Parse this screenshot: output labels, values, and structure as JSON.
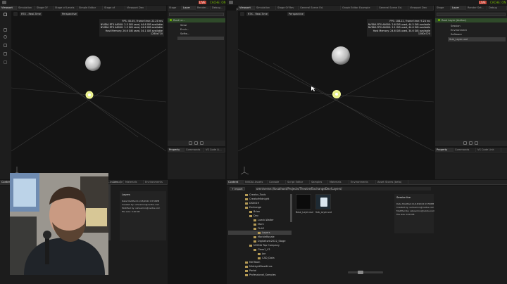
{
  "left_window": {
    "menu": [
      "File",
      "Edit",
      "Create",
      "Window",
      "Replicator",
      "Omniverse",
      "Layout",
      "Help"
    ],
    "live_badge": "LIVE",
    "cache_label": "CACHE: ON",
    "tabs": [
      "Viewport",
      "Simulation",
      "Stage Of Rev",
      "Stage of Levels",
      "Simple Editor Stage",
      "Stage of Levels",
      "Viewport Dev"
    ],
    "right_tabs": [
      "Stage",
      "Layer",
      "Render...",
      "Debug..."
    ],
    "viewport_toolbar": [
      "RTX - Real-Time",
      "Perspective"
    ],
    "stats": [
      "FPS: 45.05, Frame time: 22.20 ms",
      "NVIDIA RTX A6000: 2.5 GiB used, 44.6 GiB available",
      "NVIDIA RTX A6000: 1.5 GiB used, 44.6 GiB available",
      "Host Memory: 26.6 GiB used, 34.1 GiB available",
      "1280x720"
    ],
    "layer_rows": [
      "Root La...",
      "Sessi",
      "Envir...",
      "Softw..."
    ],
    "bottom_tabs": [
      "Property",
      "Commands",
      "VS Code Li..."
    ],
    "content_tabs": [
      "Content",
      "NVIDIA Assets",
      "Console",
      "Materials",
      "Environments"
    ],
    "file_panel": {
      "name": "Layers",
      "info": [
        "Date Modified:11/18/2022 03:58PM",
        "Created by: vshoemnn@nvidia.com",
        "Modified by: vshoemnn@nvidia.com",
        "File size: 0.00 KB"
      ]
    }
  },
  "right_window": {
    "menu": [
      "File",
      "Edit",
      "Create",
      "Window",
      "Replicator",
      "Omniverse",
      "Layout",
      "Help"
    ],
    "live_badge": "LIVE",
    "cache_label": "CACHE: ON",
    "tabs": [
      "Viewport",
      "Simulation",
      "Stage Of Rev",
      "General Scene Ed. Documentation",
      "Graph Editor Example",
      "General Scene Ed.",
      "Viewport Dev"
    ],
    "right_tabs": [
      "Stage",
      "Layer",
      "Render Set...",
      "Debug Sett..."
    ],
    "viewport_toolbar": [
      "RTX - Real-Time",
      "Perspective"
    ],
    "stats": [
      "FPS: 108.22, Frame time: 9.24 ms",
      "NVIDIA RTX A6000: 2.6 GiB used, 44.5 GiB available",
      "NVIDIA RTX A6000: 2.1 GiB used, 44.6 GiB available",
      "Host Memory: 24.6 GiB used, 34.6 GiB available",
      "1280x720"
    ],
    "layer_rows": [
      "Root Layer (Author)",
      "Session",
      "Environment",
      "Software",
      "Sub_Layer.usd"
    ],
    "bottom_tabs": [
      "Property",
      "Commands",
      "VS Code Link"
    ],
    "content_tabs": [
      "Content",
      "NVIDIA Assets",
      "Console",
      "Script Editor",
      "Samples",
      "Materials",
      "Environments",
      "Asset Stores (beta)"
    ],
    "import_label": "+ Import",
    "path": "omniverse://localhost/Projects/Theatre/ExchangeDev/Layers/",
    "tree": [
      "Creator_Tools",
      "CreatorMidnight",
      "DS0019",
      "Exchange",
      "Brian",
      "Dev",
      "Lueck-Walter",
      "Mark",
      "FLAG",
      "Layers",
      "MarbleRoyale",
      "Digitaltwin2022_Stage",
      "NVIDIA Top Company",
      "Class1_V1",
      "Joe",
      "CAD_Data",
      "MeiTeam",
      "MidnightDeadlines",
      "Portal",
      "Professional_Samples"
    ],
    "files": [
      "Base_Layer.usd",
      "Sub_Layer.usd"
    ],
    "file_panel": {
      "name": "Sessionlive",
      "info": [
        "Date Modified:11/18/2022 03:58PM",
        "Created by: vshoemnn@nvidia.com",
        "Modified by: vshoemnn@nvidia.com",
        "File size: 0.00 KB"
      ]
    }
  },
  "colors": {
    "accent_green": "#76b900",
    "live_red": "#c0392b",
    "folder": "#b49a55"
  }
}
